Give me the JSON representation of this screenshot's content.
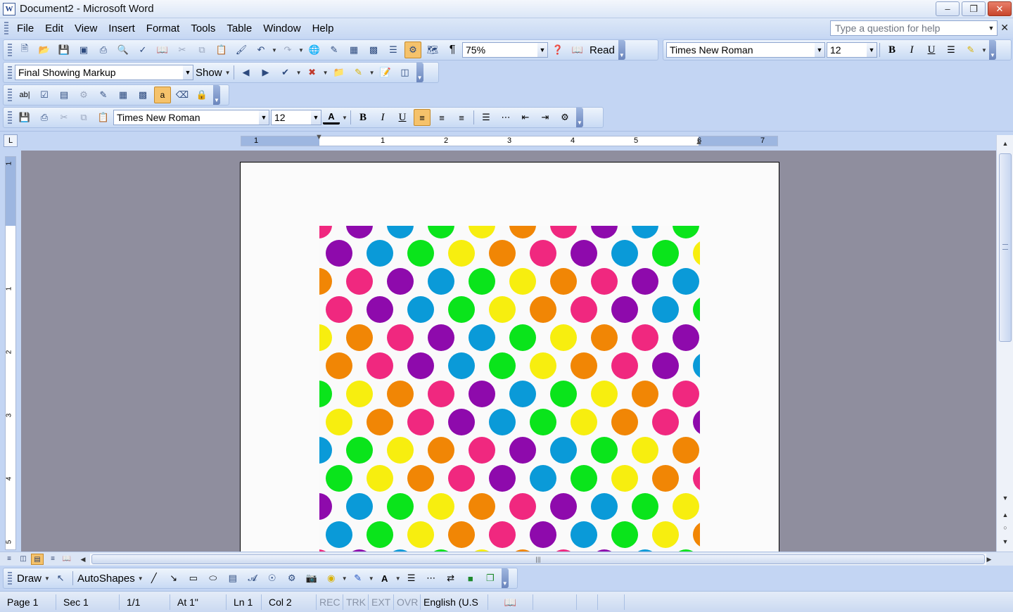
{
  "window": {
    "title": "Document2 - Microsoft Word",
    "app_icon": "W"
  },
  "menu": {
    "items": [
      "File",
      "Edit",
      "View",
      "Insert",
      "Format",
      "Tools",
      "Table",
      "Window",
      "Help"
    ],
    "help_placeholder": "Type a question for help"
  },
  "standard_toolbar": {
    "zoom": "75%",
    "read_label": "Read",
    "font": "Times New Roman",
    "size": "12"
  },
  "reviewing_toolbar": {
    "display_mode": "Final Showing Markup",
    "show_label": "Show"
  },
  "formatting_toolbar": {
    "font": "Times New Roman",
    "size": "12",
    "bold": "B",
    "italic": "I",
    "underline": "U"
  },
  "ruler": {
    "numbers": [
      "1",
      "1",
      "2",
      "3",
      "4",
      "5",
      "6",
      "7"
    ],
    "corner": "L"
  },
  "vruler": {
    "numbers": [
      "1",
      "1",
      "2",
      "3",
      "4",
      "5"
    ]
  },
  "dot_colors": {
    "pink": "#f0287f",
    "purple": "#8e0aac",
    "blue": "#0a9ad8",
    "green": "#0ae41b",
    "yellow": "#f7ee0f",
    "orange": "#f18605"
  },
  "drawing_toolbar": {
    "draw_label": "Draw",
    "autoshapes_label": "AutoShapes"
  },
  "status": {
    "page": "Page 1",
    "sec": "Sec 1",
    "pages": "1/1",
    "at": "At 1\"",
    "ln": "Ln 1",
    "col": "Col 2",
    "rec": "REC",
    "trk": "TRK",
    "ext": "EXT",
    "ovr": "OVR",
    "lang": "English (U.S"
  }
}
